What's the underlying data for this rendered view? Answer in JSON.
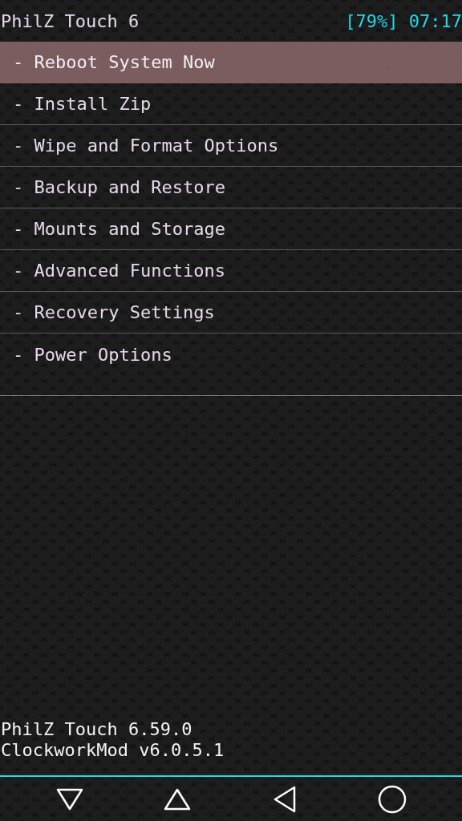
{
  "header": {
    "title": "PhilZ Touch 6",
    "battery": "[79%]",
    "time": "07:17"
  },
  "menu": [
    {
      "label": "- Reboot System Now",
      "selected": true
    },
    {
      "label": "- Install Zip",
      "selected": false
    },
    {
      "label": "- Wipe and Format Options",
      "selected": false
    },
    {
      "label": "- Backup and Restore",
      "selected": false
    },
    {
      "label": "- Mounts and Storage",
      "selected": false
    },
    {
      "label": "- Advanced Functions",
      "selected": false
    },
    {
      "label": "- Recovery Settings",
      "selected": false
    },
    {
      "label": "- Power Options",
      "selected": false
    }
  ],
  "footer": [
    "PhilZ Touch 6.59.0",
    "ClockworkMod v6.0.5.1"
  ],
  "nav_bar": [
    {
      "kind": "down"
    },
    {
      "kind": "up"
    },
    {
      "kind": "back"
    },
    {
      "kind": "home"
    }
  ]
}
